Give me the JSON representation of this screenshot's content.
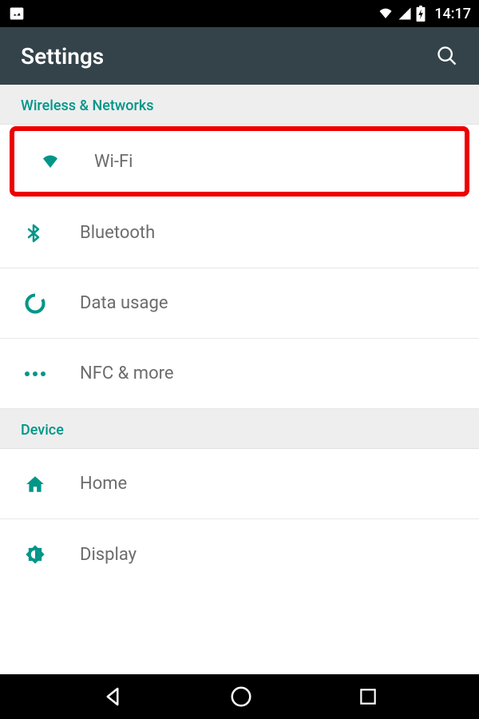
{
  "status_bar": {
    "time": "14:17"
  },
  "header": {
    "title": "Settings"
  },
  "sections": {
    "wireless": {
      "title": "Wireless & Networks",
      "items": {
        "wifi": {
          "label": "Wi-Fi",
          "icon": "wifi-icon",
          "highlighted": true
        },
        "bluetooth": {
          "label": "Bluetooth",
          "icon": "bluetooth-icon"
        },
        "data_usage": {
          "label": "Data usage",
          "icon": "data-usage-icon"
        },
        "nfc": {
          "label": "NFC & more",
          "icon": "more-icon"
        }
      }
    },
    "device": {
      "title": "Device",
      "items": {
        "home": {
          "label": "Home",
          "icon": "home-icon"
        },
        "display": {
          "label": "Display",
          "icon": "display-icon"
        }
      }
    }
  },
  "colors": {
    "accent": "#009688",
    "highlight": "#ee0000",
    "header_bg": "#34434a"
  }
}
